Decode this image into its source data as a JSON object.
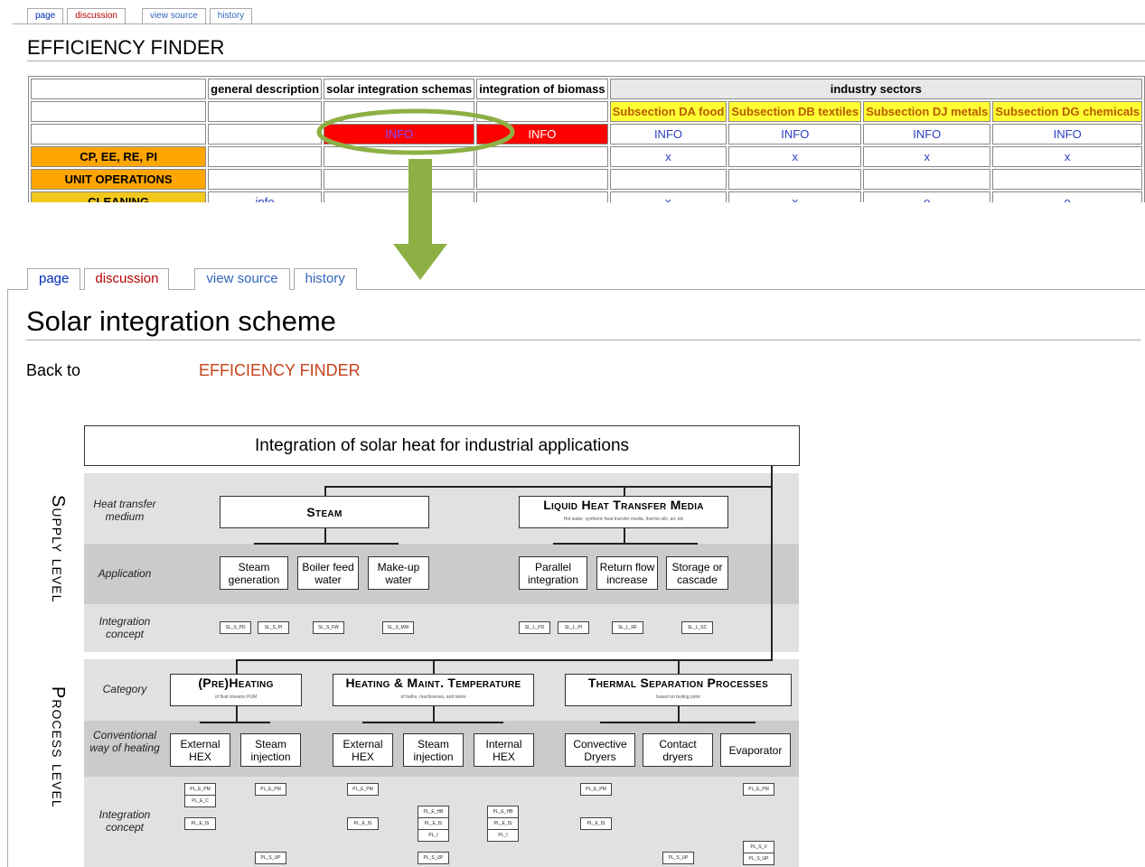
{
  "top": {
    "tabs": [
      "page",
      "discussion",
      "view source",
      "history"
    ],
    "title": "EFFICIENCY FINDER",
    "table": {
      "headers": [
        "general description",
        "solar integration schemas",
        "integration of biomass",
        "industry sectors"
      ],
      "subsections": [
        "Subsection DA food",
        "Subsection DB textiles",
        "Subsection DJ metals",
        "Subsection DG chemicals"
      ],
      "info": "INFO",
      "rows": [
        {
          "label": "CP, EE, RE, PI",
          "marks": [
            "x",
            "x",
            "x",
            "x"
          ]
        },
        {
          "label": "UNIT OPERATIONS",
          "marks": [
            "",
            "",
            "",
            ""
          ]
        },
        {
          "label": "CLEANING",
          "desc": "info",
          "marks": [
            "x",
            "x",
            "o",
            "o"
          ]
        }
      ]
    }
  },
  "bottom": {
    "tabs": [
      "page",
      "discussion",
      "view source",
      "history"
    ],
    "title": "Solar integration scheme",
    "back_to": "Back to",
    "efficiency_link": "EFFICIENCY FINDER",
    "diagram": {
      "title": "Integration of solar heat for industrial applications",
      "supply_level": "Supply level",
      "process_level": "Process level",
      "rows": {
        "heat_transfer_medium": "Heat transfer medium",
        "application": "Application",
        "integration_concept": "Integration concept",
        "category": "Category",
        "conventional": "Conventional way of heating"
      },
      "steam": "Steam",
      "liquid": "Liquid Heat Transfer Media",
      "liquid_sub": "Hot water, synthetic heat transfer media, thermo oils, air, etc",
      "steam_apps": [
        "Steam generation",
        "Boiler feed water",
        "Make-up water"
      ],
      "liquid_apps": [
        "Parallel integration",
        "Return flow increase",
        "Storage or cascade"
      ],
      "supply_concepts": [
        "SL_S_PD",
        "SL_S_PI",
        "SL_S_FW",
        "SL_S_MW",
        "SL_L_PD",
        "SL_L_PI",
        "SL_L_RF",
        "SL_L_SC"
      ],
      "preheating": "(Pre)Heating",
      "preheating_sub": "of fluid streams PUM",
      "heating": "Heating & Maint. Temperature",
      "heating_sub": "of baths, machineries, and tanks",
      "thermal": "Thermal Separation Processes",
      "thermal_sub": "based on boiling point",
      "conv": [
        "External HEX",
        "Steam injection",
        "External HEX",
        "Steam injection",
        "Internal HEX",
        "Convective Dryers",
        "Contact dryers",
        "Evaporator"
      ],
      "process_concepts": [
        "PL_E_PM",
        "PL_E_C",
        "PL_E_IS",
        "PL_S_UP",
        "PL_E_HB",
        "PL_I",
        "PL_S_V"
      ]
    }
  }
}
